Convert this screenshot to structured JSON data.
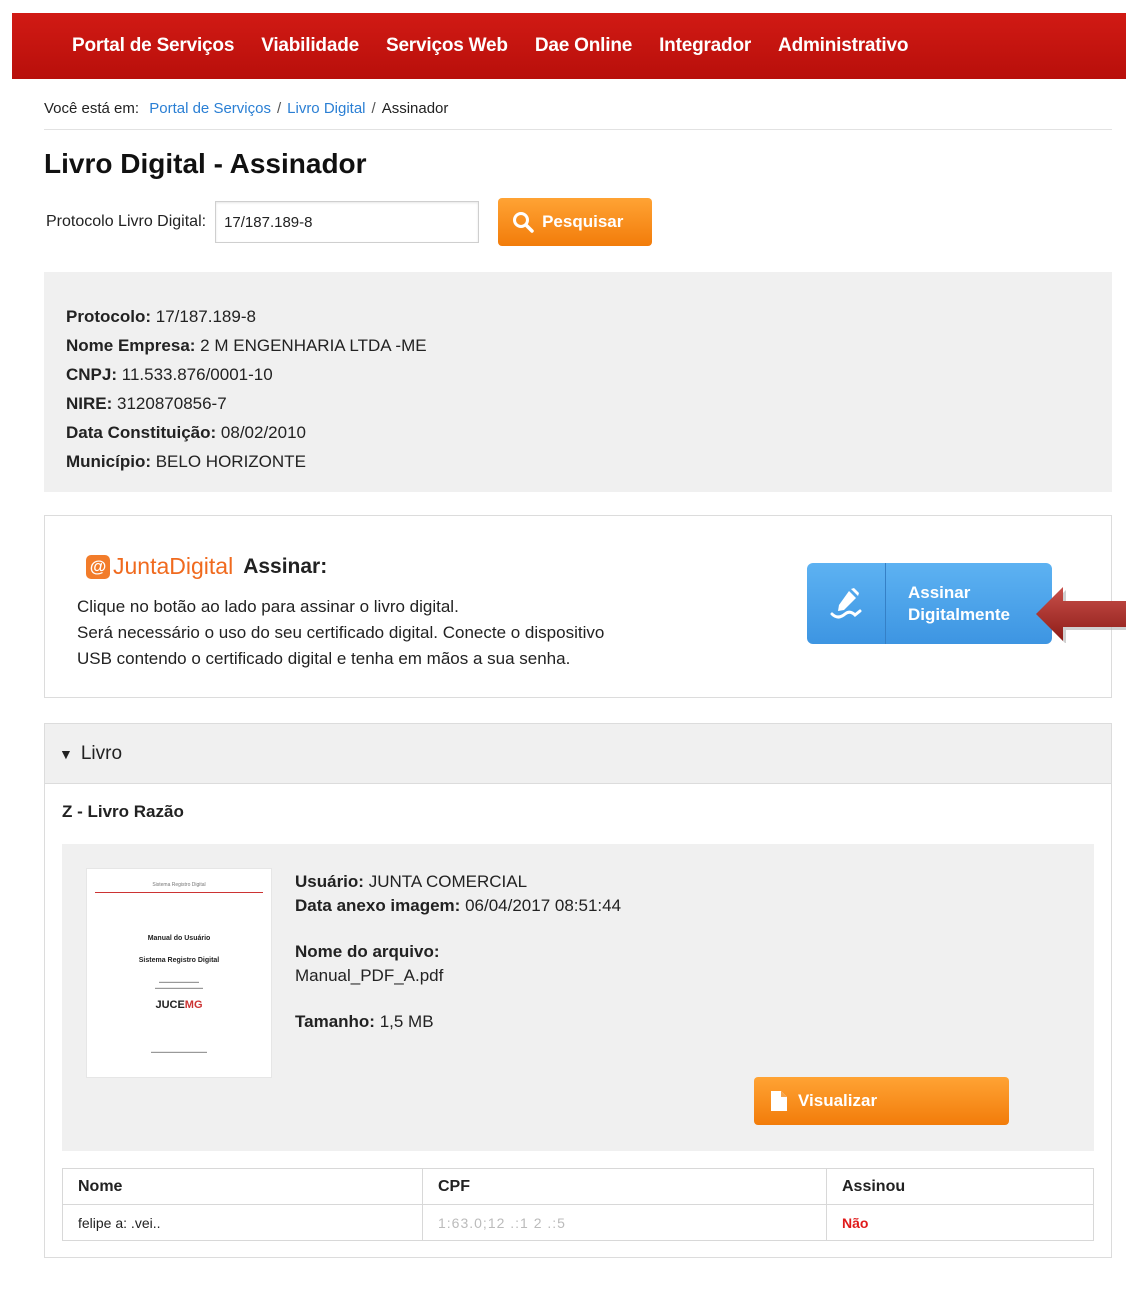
{
  "nav": {
    "items": [
      "Portal de Serviços",
      "Viabilidade",
      "Serviços Web",
      "Dae Online",
      "Integrador",
      "Administrativo"
    ]
  },
  "breadcrumb": {
    "prefix": "Você está em:",
    "links": [
      "Portal de Serviços",
      "Livro Digital"
    ],
    "current": "Assinador",
    "separator": "/"
  },
  "page": {
    "title": "Livro Digital - Assinador"
  },
  "search": {
    "label": "Protocolo Livro Digital:",
    "value": "17/187.189-8",
    "button": "Pesquisar"
  },
  "company": {
    "fields": [
      {
        "label": "Protocolo:",
        "value": "17/187.189-8"
      },
      {
        "label": "Nome Empresa:",
        "value": "2 M ENGENHARIA LTDA -ME"
      },
      {
        "label": "CNPJ:",
        "value": "11.533.876/0001-10"
      },
      {
        "label": "NIRE:",
        "value": "3120870856-7"
      },
      {
        "label": "Data Constituição:",
        "value": "08/02/2010"
      },
      {
        "label": "Município:",
        "value": "BELO HORIZONTE"
      }
    ]
  },
  "sign": {
    "brand_bold": "Junta",
    "brand_thin": "Digital",
    "title": "Assinar:",
    "text_lines": [
      "Clique no botão ao lado para assinar o livro digital.",
      "Será necessário o uso do seu certificado digital. Conecte o dispositivo",
      "USB contendo o certificado digital e tenha em mãos a sua senha."
    ],
    "button_line1": "Assinar",
    "button_line2": "Digitalmente"
  },
  "livro": {
    "panel_title": "Livro",
    "book_name": "Z - Livro Razão",
    "thumbnail": {
      "header": "Sistema Registro Digital",
      "title1": "Manual do Usuário",
      "title2": "Sistema Registro Digital",
      "logo_a": "JUCE",
      "logo_b": "MG"
    },
    "file": {
      "user_label": "Usuário:",
      "user_value": "JUNTA COMERCIAL",
      "date_label": "Data anexo imagem:",
      "date_value": "06/04/2017 08:51:44",
      "filename_label": "Nome do arquivo:",
      "filename_value": "Manual_PDF_A.pdf",
      "size_label": "Tamanho:",
      "size_value": "1,5 MB"
    },
    "view_button": "Visualizar",
    "table": {
      "headers": [
        "Nome",
        "CPF",
        "Assinou"
      ],
      "rows": [
        {
          "nome": "felipe a: .vei..",
          "cpf": "1:63.0;12 .:1 2 .:5",
          "assinou": "Não"
        }
      ]
    }
  },
  "colors": {
    "nav_red": "#c4130e",
    "link_blue": "#2a7fd4",
    "orange": "#f5870f",
    "sign_blue": "#4aa3ea",
    "no_red": "#e01b1b"
  }
}
